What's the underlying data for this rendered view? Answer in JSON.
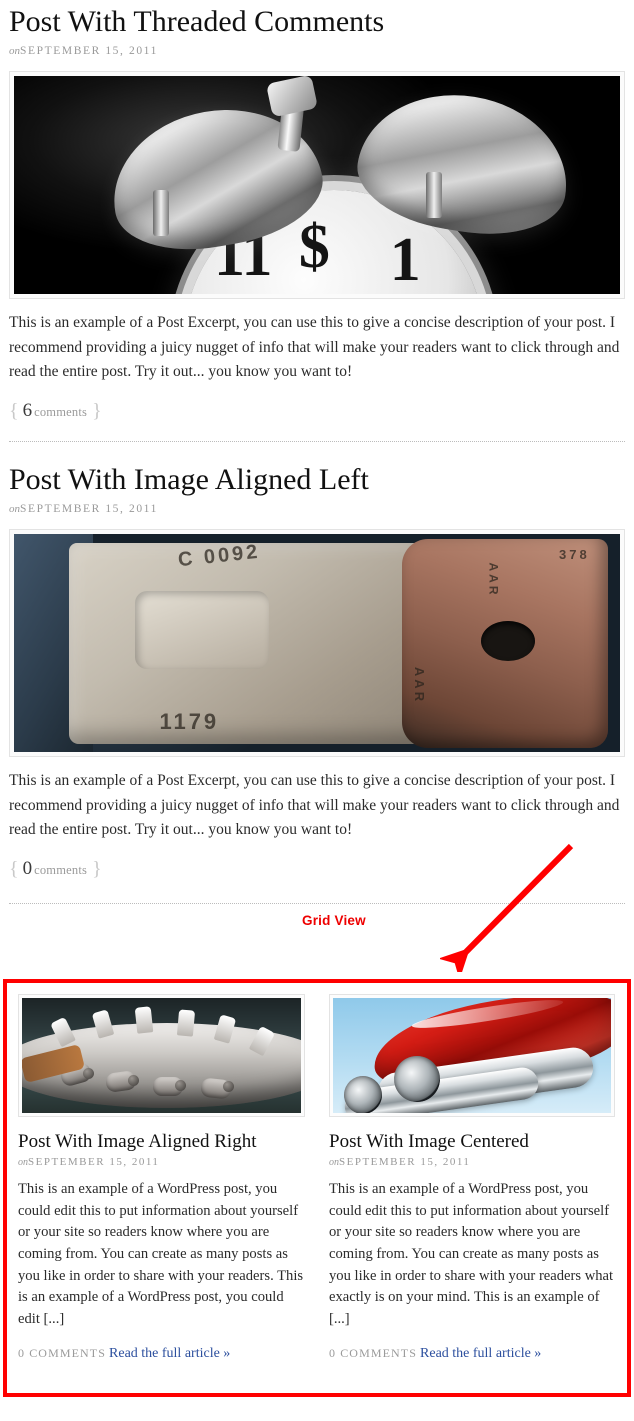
{
  "posts": [
    {
      "title": "Post With Threaded Comments",
      "meta_on": "on",
      "meta_date": "SEPTEMBER 15, 2011",
      "image_alt": "alarm-clock-photo",
      "excerpt": "This is an example of a Post Excerpt, you can use this to give a concise description of your post. I recommend providing a juicy nugget of info that will make your readers want to click through and read the entire post. Try it out... you know you want to!",
      "comments_open_brace": "{",
      "comments_count": "6",
      "comments_word": "comments",
      "comments_close_brace": "}"
    },
    {
      "title": "Post With Image Aligned Left",
      "meta_on": "on",
      "meta_date": "SEPTEMBER 15, 2011",
      "image_alt": "rusty-metal-coupler-photo",
      "excerpt": "This is an example of a Post Excerpt, you can use this to give a concise description of your post. I recommend providing a juicy nugget of info that will make your readers want to click through and read the entire post. Try it out... you know you want to!",
      "comments_open_brace": "{",
      "comments_count": "0",
      "comments_word": "comments",
      "comments_close_brace": "}"
    }
  ],
  "annotation": {
    "label": "Grid View",
    "color": "#ee0000",
    "arrow": "red-arrow-pointing-down-left"
  },
  "grid": {
    "highlight_color": "#ff0000",
    "columns": [
      {
        "title": "Post With Image Aligned Right",
        "meta_on": "on",
        "meta_date": "SEPTEMBER 15, 2011",
        "image_alt": "bicycle-chainring-photo",
        "text": "This is an example of a WordPress post, you could edit this to put information about yourself or your site so readers know where you are coming from. You can create as many posts as you like in order to share with your readers. This is an example of a WordPress post, you could edit [...]",
        "comments_label": "0 COMMENTS",
        "read_more": "Read the full article »"
      },
      {
        "title": "Post With Image Centered",
        "meta_on": "on",
        "meta_date": "SEPTEMBER 15, 2011",
        "image_alt": "red-motorcycle-exhaust-photo",
        "text": "This is an example of a WordPress post, you could edit this to put information about yourself or your site so readers know where you are coming from. You can create as many posts as you like in order to share with your readers what exactly is on your mind. This is an example of [...]",
        "comments_label": "0 COMMENTS",
        "read_more": "Read the full article »"
      }
    ]
  }
}
